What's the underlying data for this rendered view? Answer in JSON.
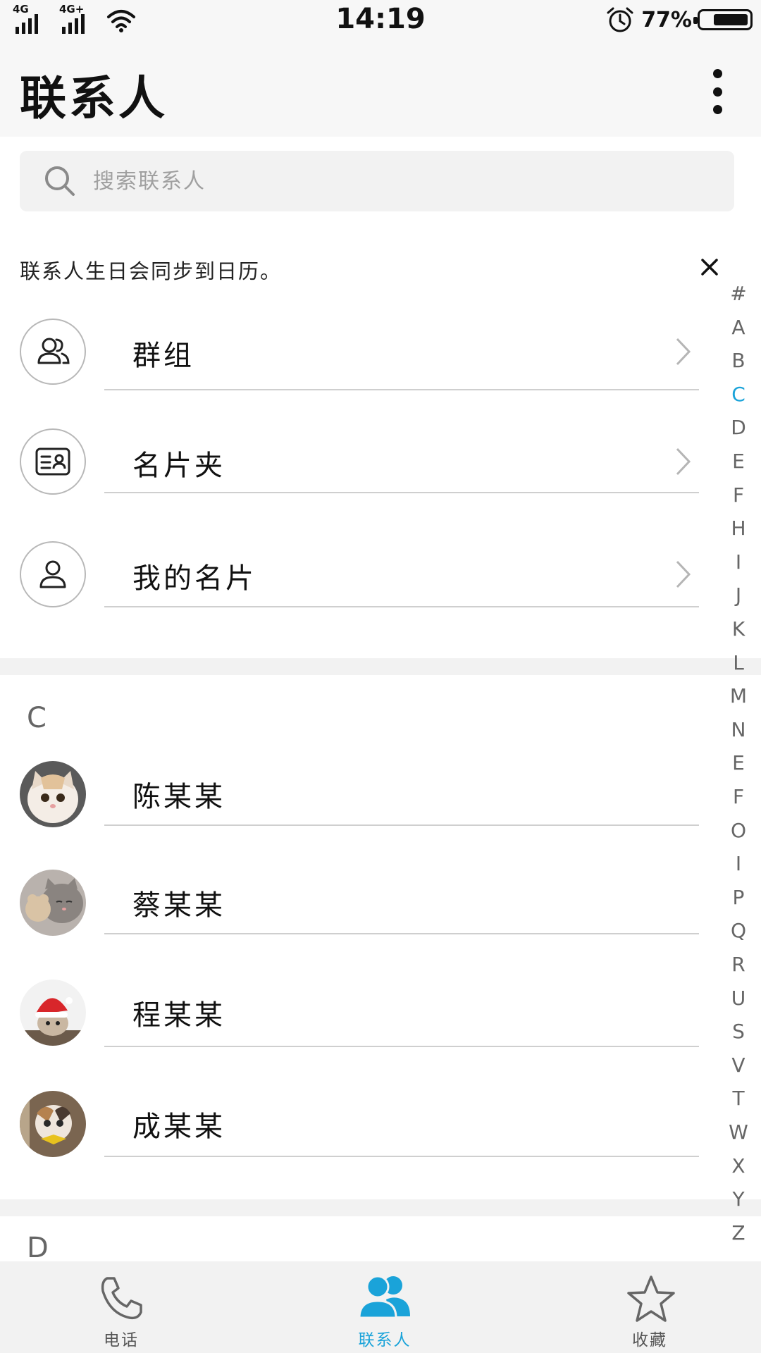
{
  "status_bar": {
    "network1": "4G",
    "network2": "4G+",
    "time": "14:19",
    "battery_percent": "77%",
    "battery_level": 0.77
  },
  "header": {
    "title": "联系人",
    "more_icon": "more-vertical-icon"
  },
  "search": {
    "placeholder": "搜索联系人"
  },
  "notice": {
    "text": "联系人生日会同步到日历。"
  },
  "menu_items": [
    {
      "label": "群组",
      "icon": "group-icon"
    },
    {
      "label": "名片夹",
      "icon": "card-holder-icon"
    },
    {
      "label": "我的名片",
      "icon": "my-card-icon"
    }
  ],
  "sections": [
    {
      "letter": "C",
      "contacts": [
        {
          "name": "陈某某"
        },
        {
          "name": "蔡某某"
        },
        {
          "name": "程某某"
        },
        {
          "name": "成某某"
        }
      ]
    },
    {
      "letter": "D",
      "contacts": []
    }
  ],
  "index_letters": [
    "#",
    "A",
    "B",
    "C",
    "D",
    "E",
    "F",
    "H",
    "I",
    "J",
    "K",
    "L",
    "M",
    "N",
    "E",
    "F",
    "O",
    "I",
    "P",
    "Q",
    "R",
    "U",
    "S",
    "V",
    "T",
    "W",
    "X",
    "Y",
    "Z"
  ],
  "index_active": "C",
  "bottom_nav": [
    {
      "label": "电话",
      "icon": "phone-icon",
      "active": false
    },
    {
      "label": "联系人",
      "icon": "contacts-icon",
      "active": true
    },
    {
      "label": "收藏",
      "icon": "star-icon",
      "active": false
    }
  ],
  "colors": {
    "accent": "#1aa3d9",
    "header_bg": "#f7f7f7",
    "divider": "#cfcfcf"
  }
}
